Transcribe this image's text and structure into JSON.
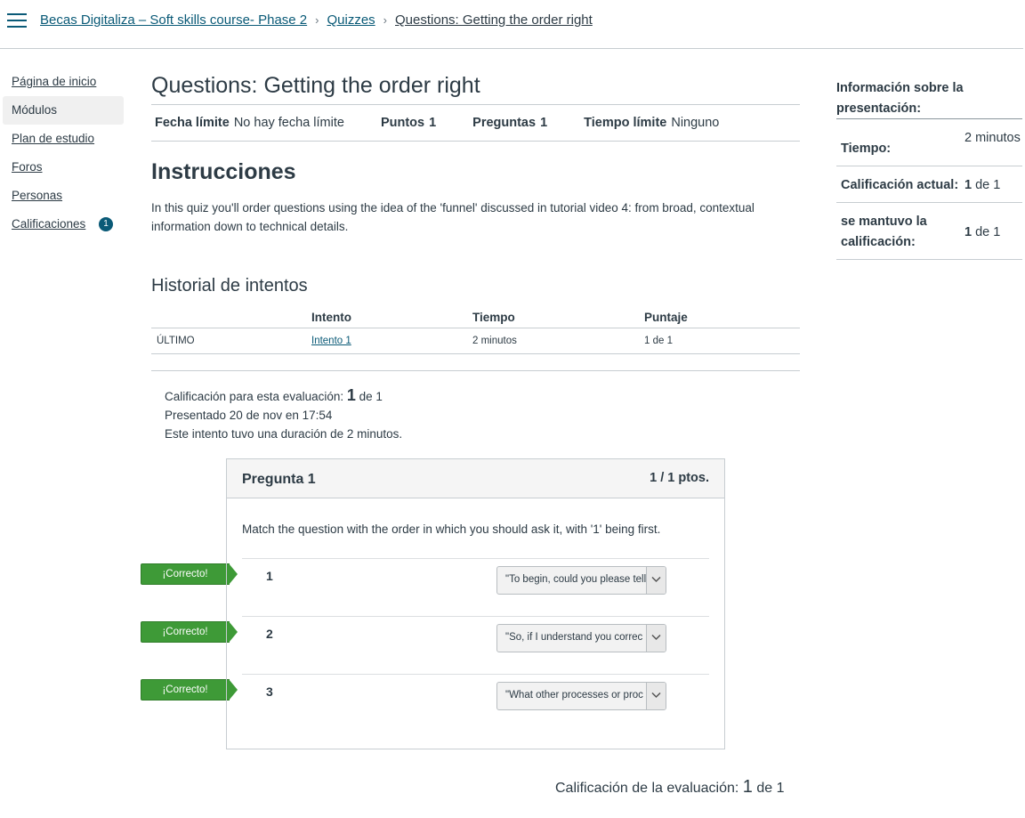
{
  "breadcrumb": {
    "course": "Becas Digitaliza – Soft skills course- Phase 2",
    "section": "Quizzes",
    "current": "Questions: Getting the order right"
  },
  "nav": {
    "items": [
      {
        "label": "Página de inicio"
      },
      {
        "label": "Módulos"
      },
      {
        "label": "Plan de estudio"
      },
      {
        "label": "Foros"
      },
      {
        "label": "Personas"
      },
      {
        "label": "Calificaciones",
        "badge": "1"
      }
    ]
  },
  "quiz": {
    "title": "Questions: Getting the order right",
    "meta": {
      "due_label": "Fecha límite",
      "due_value": "No hay fecha límite",
      "points_label": "Puntos",
      "points_value": "1",
      "questions_label": "Preguntas",
      "questions_value": "1",
      "time_label": "Tiempo límite",
      "time_value": "Ninguno"
    },
    "instructions_heading": "Instrucciones",
    "instructions_text": "In this quiz you'll order questions using the idea of the 'funnel' discussed in tutorial video 4: from broad, contextual information down to technical details."
  },
  "history": {
    "heading": "Historial de intentos",
    "columns": [
      "",
      "Intento",
      "Tiempo",
      "Puntaje"
    ],
    "rows": [
      {
        "tag": "ÚLTIMO",
        "attempt": "Intento 1",
        "time": "2 minutos",
        "score": "1 de 1"
      }
    ]
  },
  "summary": {
    "score_prefix": "Calificación para esta evaluación: ",
    "score": "1",
    "score_suffix": " de 1",
    "submitted": "Presentado 20 de nov en 17:54",
    "duration": "Este intento tuvo una duración de 2 minutos."
  },
  "question": {
    "title": "Pregunta 1",
    "points": "1 / 1 ptos.",
    "text": "Match the question with the order in which you should ask it, with '1' being first.",
    "correct_label": "¡Correcto!",
    "rows": [
      {
        "num": "1",
        "answer": "\"To begin, could you please tell"
      },
      {
        "num": "2",
        "answer": "\"So, if I understand you correc"
      },
      {
        "num": "3",
        "answer": "\"What other processes or proc"
      }
    ]
  },
  "final": {
    "prefix": "Calificación de la evaluación: ",
    "score": "1",
    "suffix": " de 1"
  },
  "sidebar": {
    "heading": "Información sobre la presentación:",
    "rows": [
      {
        "key": "Tiempo:",
        "value": "2 minutos"
      },
      {
        "key": "Calificación actual:",
        "score": "1",
        "suffix": " de 1"
      },
      {
        "key": "se mantuvo la calificación:",
        "score": "1",
        "suffix": " de 1"
      }
    ]
  },
  "colors": {
    "link": "#0a5a77",
    "correct": "#3e9a37",
    "text": "#2d3b45"
  }
}
